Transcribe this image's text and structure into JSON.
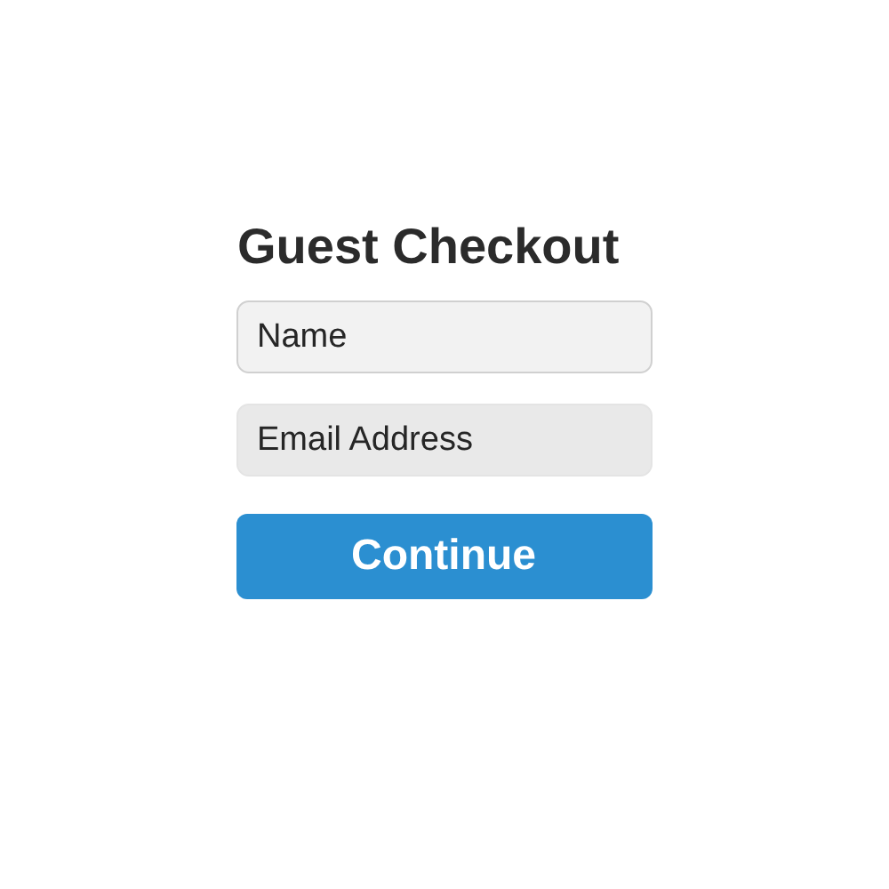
{
  "title": "Guest Checkout",
  "fields": [
    {
      "placeholder": "Name"
    },
    {
      "placeholder": "Email Address"
    }
  ],
  "button": {
    "label": "Continue"
  }
}
